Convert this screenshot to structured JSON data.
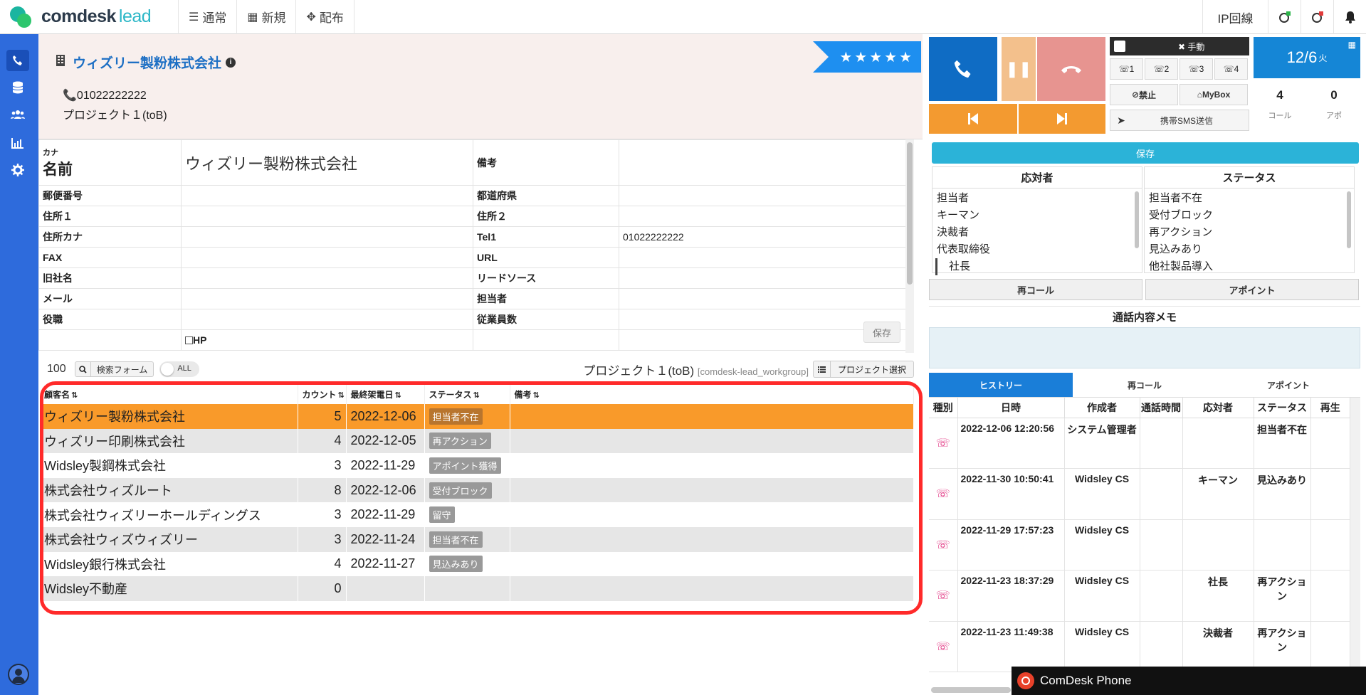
{
  "app": {
    "brand": "comdesk",
    "brand_suffix": "lead"
  },
  "topnav": [
    {
      "icon": "list-icon",
      "glyph": "☰",
      "label": "通常"
    },
    {
      "icon": "grid-icon",
      "glyph": "▦",
      "label": "新規"
    },
    {
      "icon": "distribute-icon",
      "glyph": "✥",
      "label": "配布"
    }
  ],
  "topright": {
    "ip_line": "IP回線"
  },
  "company": {
    "name": "ウィズリー製粉株式会社",
    "phone": "01022222222",
    "project": "プロジェクト１(toB)",
    "stars": "★★★★★"
  },
  "form": {
    "kana_label": "カナ",
    "name_label": "名前",
    "name_value": "ウィズリー製粉株式会社",
    "remarks_label": "備考",
    "rows": [
      {
        "l1": "郵便番号",
        "v1": "",
        "l2": "都道府県",
        "v2": ""
      },
      {
        "l1": "住所１",
        "v1": "",
        "l2": "住所２",
        "v2": ""
      },
      {
        "l1": "住所カナ",
        "v1": "",
        "l2": "Tel1",
        "v2": "01022222222"
      },
      {
        "l1": "FAX",
        "v1": "",
        "l2": "URL",
        "v2": ""
      },
      {
        "l1": "旧社名",
        "v1": "",
        "l2": "リードソース",
        "v2": ""
      },
      {
        "l1": "メール",
        "v1": "",
        "l2": "担当者",
        "v2": ""
      },
      {
        "l1": "役職",
        "v1": "",
        "l2": "従業員数",
        "v2": ""
      }
    ],
    "hp_label": "HP",
    "save_label": "保存"
  },
  "listbar": {
    "count": "100",
    "search_label": "検索フォーム",
    "toggle_label": "ALL",
    "project": "プロジェクト１(toB)",
    "workgroup": "[comdesk-lead_workgroup]",
    "project_select": "プロジェクト選択"
  },
  "list": {
    "headers": {
      "name": "顧客名",
      "count": "カウント",
      "last": "最終架電日",
      "status": "ステータス",
      "memo": "備考"
    },
    "rows": [
      {
        "name": "ウィズリー製粉株式会社",
        "count": "5",
        "date": "2022-12-06",
        "status": "担当者不在",
        "memo": ""
      },
      {
        "name": "ウィズリー印刷株式会社",
        "count": "4",
        "date": "2022-12-05",
        "status": "再アクション",
        "memo": ""
      },
      {
        "name": "Widsley製鋼株式会社",
        "count": "3",
        "date": "2022-11-29",
        "status": "アポイント獲得",
        "memo": ""
      },
      {
        "name": "株式会社ウィズルート",
        "count": "8",
        "date": "2022-12-06",
        "status": "受付ブロック",
        "memo": ""
      },
      {
        "name": "株式会社ウィズリーホールディングス",
        "count": "3",
        "date": "2022-11-29",
        "status": "留守",
        "memo": ""
      },
      {
        "name": "株式会社ウィズウィズリー",
        "count": "3",
        "date": "2022-11-24",
        "status": "担当者不在",
        "memo": ""
      },
      {
        "name": "Widsley銀行株式会社",
        "count": "4",
        "date": "2022-11-27",
        "status": "見込みあり",
        "memo": ""
      },
      {
        "name": "Widsley不動産",
        "count": "0",
        "date": "",
        "status": "",
        "memo": ""
      }
    ]
  },
  "phone": {
    "manual_label": "✖ 手動",
    "lines": [
      "1",
      "2",
      "3",
      "4"
    ],
    "ban_label": "禁止",
    "mybox_label": "MyBox",
    "sms_label": "携帯SMS送信",
    "date": "12/6",
    "weekday": "火",
    "calls": "4",
    "calls_label": "コール",
    "appts": "0",
    "appts_label": "アポ",
    "save_label": "保存",
    "responder_title": "応対者",
    "responders": [
      "担当者",
      "キーマン",
      "決裁者",
      "代表取締役",
      "社長"
    ],
    "status_title": "ステータス",
    "statuses": [
      "担当者不在",
      "受付ブロック",
      "再アクション",
      "見込みあり",
      "他社製品導入"
    ],
    "recall_label": "再コール",
    "appoint_label": "アポイント",
    "memo_title": "通話内容メモ",
    "tabs": [
      "ヒストリー",
      "再コール",
      "アポイント"
    ],
    "hist_headers": [
      "種別",
      "日時",
      "作成者",
      "通話時間",
      "応対者",
      "ステータス",
      "再生"
    ],
    "history": [
      {
        "date": "2022-12-06 12:20:56",
        "creator": "システム管理者",
        "duration": "",
        "responder": "",
        "status": "担当者不在"
      },
      {
        "date": "2022-11-30 10:50:41",
        "creator": "Widsley CS",
        "duration": "",
        "responder": "キーマン",
        "status": "見込みあり"
      },
      {
        "date": "2022-11-29 17:57:23",
        "creator": "Widsley CS",
        "duration": "",
        "responder": "",
        "status": ""
      },
      {
        "date": "2022-11-23 18:37:29",
        "creator": "Widsley CS",
        "duration": "",
        "responder": "社長",
        "status": "再アクション"
      },
      {
        "date": "2022-11-23 11:49:38",
        "creator": "Widsley CS",
        "duration": "",
        "responder": "決裁者",
        "status": "再アクション"
      }
    ],
    "cdphone_label": "ComDesk Phone"
  },
  "colors": {
    "sidebar": "#2e6bdc",
    "selected_row": "#f99a2a",
    "highlight_border": "#ff2a2a",
    "call": "#0f6cc4"
  }
}
